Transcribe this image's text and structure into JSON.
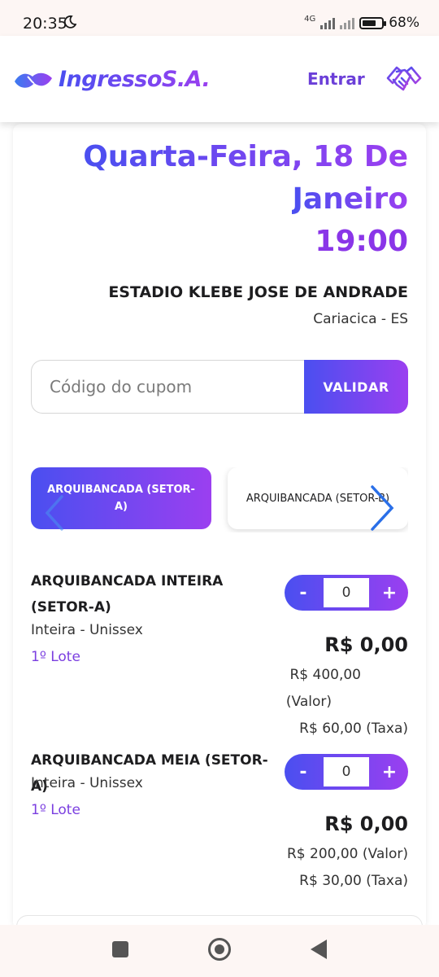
{
  "status_bar": {
    "time": "20:35",
    "network": "4G",
    "battery_pct": "68%"
  },
  "header": {
    "brand": "IngressoS.A.",
    "login_label": "Entrar"
  },
  "event": {
    "date_line1": "Quarta-Feira, 18 De",
    "date_line2": "Janeiro",
    "time": "19:00",
    "venue": "ESTADIO KLEBE JOSE DE ANDRADE",
    "city": "Cariacica - ES"
  },
  "coupon": {
    "placeholder": "Código do cupom",
    "button_label": "VALIDAR"
  },
  "sectors": [
    {
      "label": "ARQUIBANCADA (SETOR-A)",
      "active": true
    },
    {
      "label": "ARQUIBANCADA (SETOR-B)",
      "active": false
    }
  ],
  "tickets": [
    {
      "name": "ARQUIBANCADA INTEIRA (SETOR-A)",
      "type": "Inteira - Unissex",
      "lote": "1º Lote",
      "quantity": "0",
      "total": "R$ 0,00",
      "valor_line": "R$ 400,00",
      "valor_suffix": "(Valor)",
      "taxa_line": "R$ 60,00 (Taxa)"
    },
    {
      "name": "ARQUIBANCADA MEIA (SETOR-A)",
      "type": "Inteira - Unissex",
      "lote": "1º Lote",
      "quantity": "0",
      "total": "R$ 0,00",
      "valor_line": "R$ 200,00 (Valor)",
      "taxa_line": "R$ 30,00 (Taxa)"
    }
  ],
  "stepper_labels": {
    "minus": "-",
    "plus": "+"
  },
  "colors": {
    "accent_start": "#4a4ff0",
    "accent_end": "#9b3ff0",
    "lote": "#7b3fe0"
  }
}
